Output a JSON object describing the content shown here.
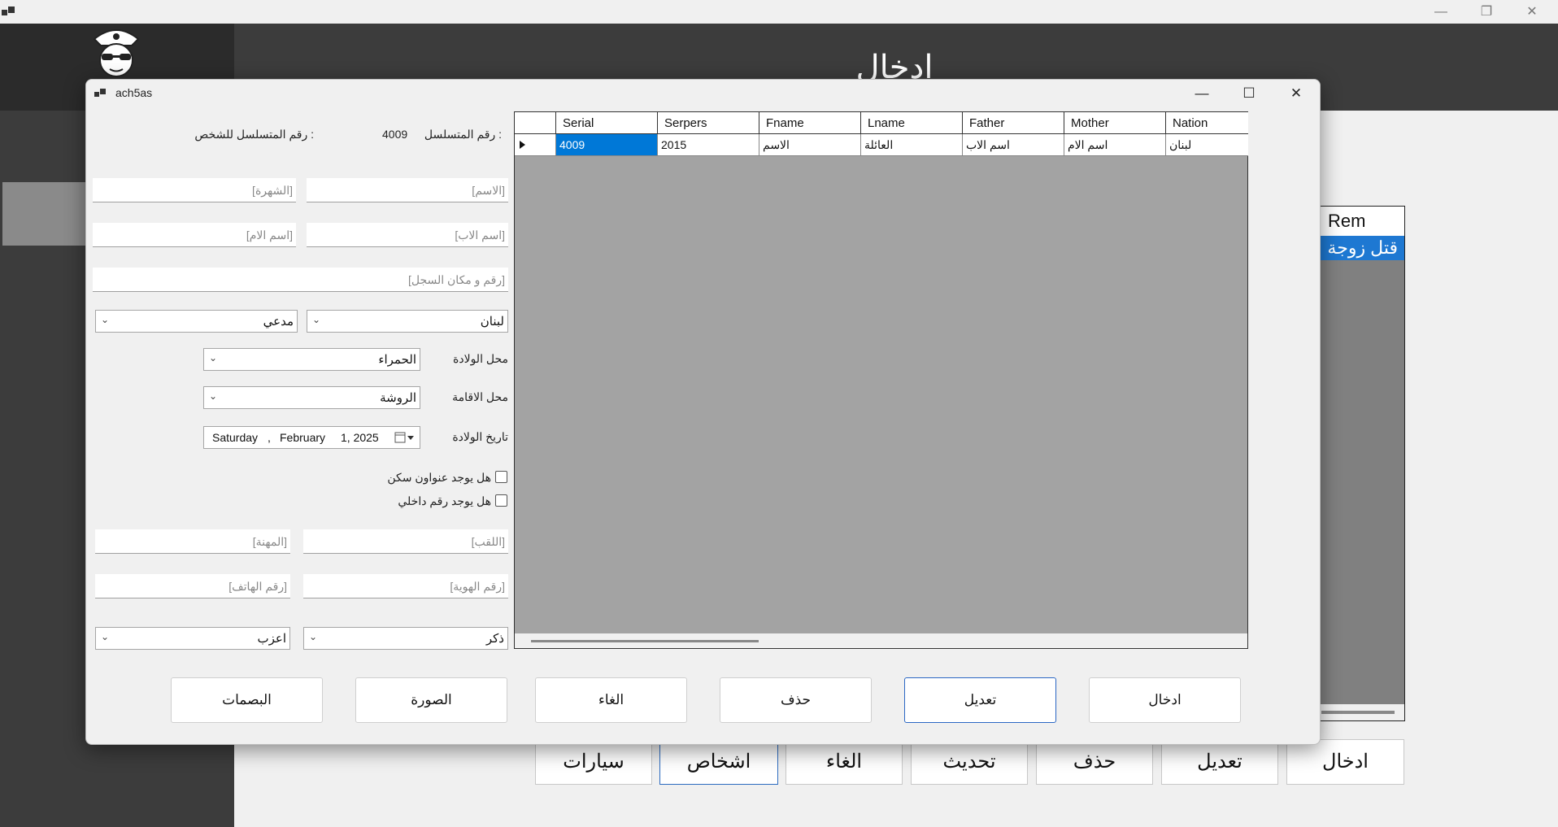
{
  "parent": {
    "header_title": "ادخال",
    "list": {
      "header": "Rem",
      "selected_row": "قتل زوجة"
    },
    "buttons": [
      {
        "label": "سيارات"
      },
      {
        "label": "اشخاص"
      },
      {
        "label": "الغاء"
      },
      {
        "label": "تحديث"
      },
      {
        "label": "حذف"
      },
      {
        "label": "تعديل"
      },
      {
        "label": "ادخال"
      }
    ]
  },
  "dialog": {
    "title": "ach5as",
    "serial_label": "رقم المتسلسل :",
    "serial_value": "4009",
    "person_serial_label": "رقم المتسلسل للشخص :",
    "fields": {
      "name_placeholder": "[الاسم]",
      "nickname_placeholder": "[الشهرة]",
      "father_placeholder": "[اسم الاب]",
      "mother_placeholder": "[اسم الام]",
      "registry_placeholder": "[رقم و مكان السجل]",
      "nation_value": "لبنان",
      "status_value": "مدعي",
      "birth_place_label": "محل الولادة",
      "birth_place_value": "الحمراء",
      "residence_label": "محل الاقامة",
      "residence_value": "الروشة",
      "birth_date_label": "تاريخ الولادة",
      "birth_date": {
        "day": "Saturday",
        "sep": ",",
        "month": "February",
        "daynum": "1, 2025"
      },
      "has_address_label": "هل يوجد عنواون سكن",
      "has_internal_label": "هل يوجد رقم داخلي",
      "title_placeholder": "[اللقب]",
      "job_placeholder": "[المهنة]",
      "id_placeholder": "[رقم الهوية]",
      "phone_placeholder": "[رقم الهاتف]",
      "gender_value": "ذكر",
      "marital_value": "اعزب"
    },
    "grid": {
      "columns": [
        "Serial",
        "Serpers",
        "Fname",
        "Lname",
        "Father",
        "Mother",
        "Nation"
      ],
      "rows": [
        [
          "4009",
          "2015",
          "الاسم",
          "العائلة",
          "اسم الاب",
          "اسم الام",
          "لبنان"
        ]
      ]
    },
    "buttons": {
      "fingerprints": "البصمات",
      "photo": "الصورة",
      "cancel": "الغاء",
      "delete": "حذف",
      "edit": "تعديل",
      "add": "ادخال"
    }
  }
}
